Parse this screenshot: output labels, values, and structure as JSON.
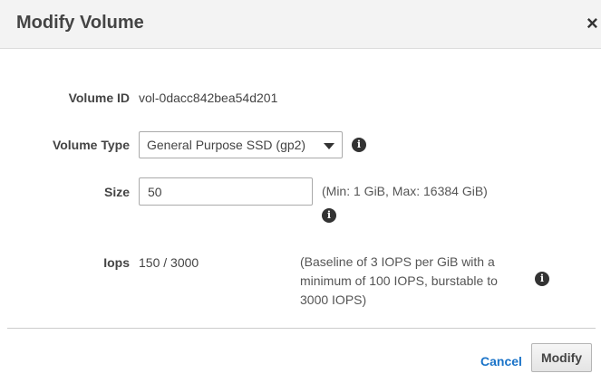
{
  "dialog": {
    "title": "Modify Volume",
    "close_glyph": "×"
  },
  "fields": {
    "volume_id": {
      "label": "Volume ID",
      "value": "vol-0dacc842bea54d201"
    },
    "volume_type": {
      "label": "Volume Type",
      "selected": "General Purpose SSD (gp2)",
      "icon": "info-icon"
    },
    "size": {
      "label": "Size",
      "value": "50",
      "hint": "(Min: 1 GiB, Max: 16384 GiB)",
      "icon": "info-icon"
    },
    "iops": {
      "label": "Iops",
      "value": "150 / 3000",
      "hint_lines": [
        "(Baseline of 3 IOPS per GiB with a",
        "minimum of 100 IOPS, burstable to",
        "3000 IOPS)"
      ],
      "icon": "info-icon"
    }
  },
  "footer": {
    "cancel_label": "Cancel",
    "modify_label": "Modify"
  },
  "colors": {
    "link": "#1a73c8",
    "header_bg": "#f3f3f3"
  }
}
